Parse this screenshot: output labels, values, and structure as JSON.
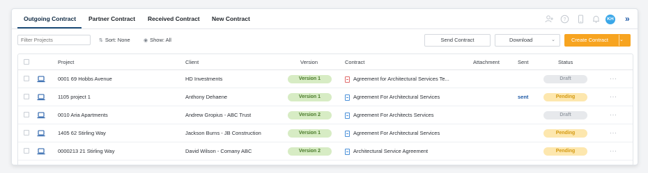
{
  "tabs": [
    {
      "label": "Outgoing Contract",
      "active": true
    },
    {
      "label": "Partner Contract",
      "active": false
    },
    {
      "label": "Received Contract",
      "active": false
    },
    {
      "label": "New Contract",
      "active": false
    }
  ],
  "header_icons": [
    "user-add-icon",
    "help-icon",
    "mobile-icon",
    "bell-icon"
  ],
  "avatar": {
    "initials": "KH",
    "color": "#3aa7e8"
  },
  "toolbar": {
    "filter_placeholder": "Filter Projects",
    "sort_label": "Sort: None",
    "show_label": "Show: All",
    "send_contract": "Send Contract",
    "download": "Download",
    "create_contract": "Create Contract"
  },
  "table": {
    "headers": {
      "project": "Project",
      "client": "Client",
      "version": "Version",
      "contract": "Contract",
      "attachment": "Attachment",
      "sent": "Sent",
      "status": "Status"
    },
    "rows": [
      {
        "project": "0001 69 Hobbs Avenue",
        "client": "HD Investments",
        "version": "Version 1",
        "contract": "Agreement for Architectural Services Te...",
        "contract_type": "pdf",
        "sent": "",
        "status": "Draft"
      },
      {
        "project": "1105 project 1",
        "client": "Anthony Dehaene",
        "version": "Version 1",
        "contract": "Agreement For Architectural Services",
        "contract_type": "doc",
        "sent": "sent",
        "status": "Pending"
      },
      {
        "project": "0010 Aria Apartments",
        "client": "Andrew Gropius - ABC Trust",
        "version": "Version 2",
        "contract": "Agreement For Architects Services",
        "contract_type": "doc",
        "sent": "",
        "status": "Draft"
      },
      {
        "project": "1405 62 Stirling Way",
        "client": "Jackson Burns - JB Construction",
        "version": "Version 1",
        "contract": "Agreement For Architectural Services",
        "contract_type": "doc",
        "sent": "",
        "status": "Pending"
      },
      {
        "project": "0000213 21 Stirling Way",
        "client": "David Wilson - Comany ABC",
        "version": "Version 2",
        "contract": "Architectural Service Agreement",
        "contract_type": "doc",
        "sent": "",
        "status": "Pending"
      }
    ]
  },
  "colors": {
    "accent": "#f7a420",
    "link": "#1f5aa6",
    "version_pill": "#d7ecc4",
    "pending_pill": "#fde7ae",
    "draft_pill": "#e7e9ec"
  }
}
